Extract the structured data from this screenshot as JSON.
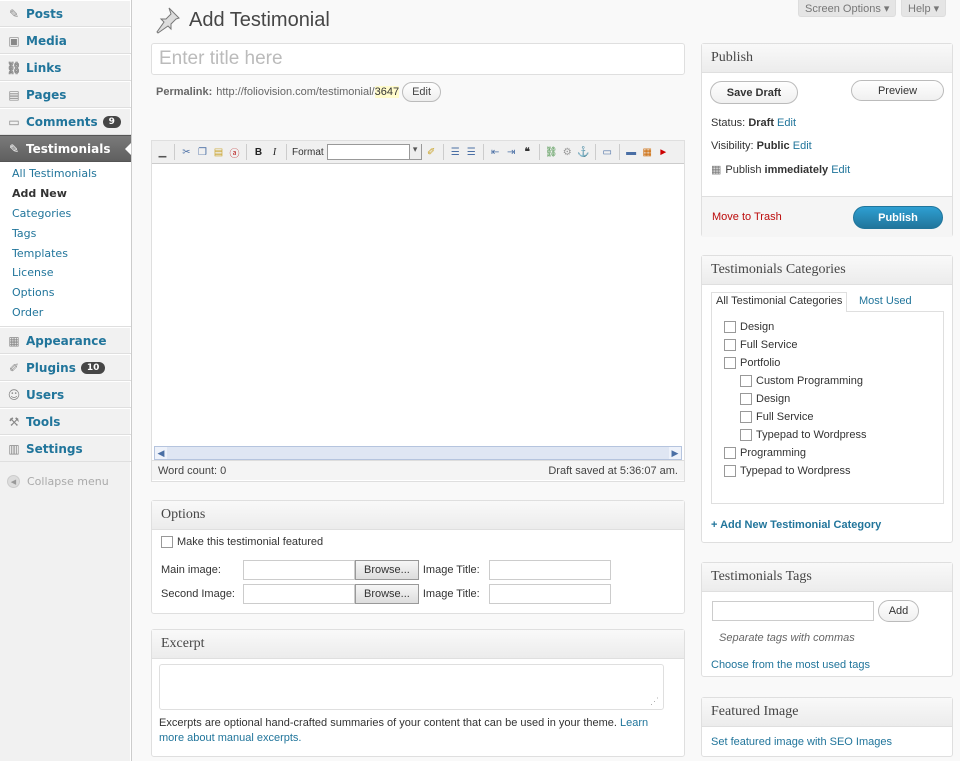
{
  "sidebar": {
    "items": [
      {
        "label": "Posts",
        "icon": "pin-icon"
      },
      {
        "label": "Media",
        "icon": "media-icon"
      },
      {
        "label": "Links",
        "icon": "link-icon"
      },
      {
        "label": "Pages",
        "icon": "pages-icon"
      },
      {
        "label": "Comments",
        "icon": "comments-icon",
        "badge": "9"
      },
      {
        "label": "Testimonials",
        "icon": "pin-icon"
      }
    ],
    "submenu": [
      "All Testimonials",
      "Add New",
      "Categories",
      "Tags",
      "Templates",
      "License",
      "Options",
      "Order"
    ],
    "items_after": [
      {
        "label": "Appearance",
        "icon": "appearance-icon"
      },
      {
        "label": "Plugins",
        "icon": "plugins-icon",
        "badge": "10"
      },
      {
        "label": "Users",
        "icon": "users-icon"
      },
      {
        "label": "Tools",
        "icon": "tools-icon"
      },
      {
        "label": "Settings",
        "icon": "settings-icon"
      }
    ],
    "collapse_label": "Collapse menu"
  },
  "top": {
    "screen_options": "Screen Options ▾",
    "help": "Help ▾"
  },
  "page": {
    "title": "Add Testimonial",
    "title_placeholder": "Enter title here",
    "permalink_label": "Permalink:",
    "permalink_base": "http://foliovision.com/testimonial/",
    "permalink_slug": "3647",
    "permalink_edit": "Edit"
  },
  "editor": {
    "format_label": "Format",
    "word_count": "Word count: 0",
    "draft_saved": "Draft saved at 5:36:07 am."
  },
  "options_box": {
    "title": "Options",
    "featured_label": "Make this testimonial featured",
    "main_image_label": "Main image:",
    "second_image_label": "Second Image:",
    "browse_label": "Browse...",
    "image_title_label": "Image Title:"
  },
  "excerpt_box": {
    "title": "Excerpt",
    "help_text": "Excerpts are optional hand-crafted summaries of your content that can be used in your theme. ",
    "link_text": "Learn more about manual excerpts."
  },
  "publish": {
    "title": "Publish",
    "save_draft": "Save Draft",
    "preview": "Preview",
    "status_label": "Status:",
    "status_value": "Draft",
    "visibility_label": "Visibility:",
    "visibility_value": "Public",
    "publish_label": "Publish",
    "publish_value": "immediately",
    "edit": "Edit",
    "trash": "Move to Trash",
    "publish_button": "Publish"
  },
  "categories": {
    "title": "Testimonials Categories",
    "tab_all": "All Testimonial Categories",
    "tab_most": "Most Used",
    "items": [
      {
        "label": "Design",
        "level": 0
      },
      {
        "label": "Full Service",
        "level": 0
      },
      {
        "label": "Portfolio",
        "level": 0
      },
      {
        "label": "Custom Programming",
        "level": 1
      },
      {
        "label": "Design",
        "level": 1
      },
      {
        "label": "Full Service",
        "level": 1
      },
      {
        "label": "Typepad to Wordpress",
        "level": 1
      },
      {
        "label": "Programming",
        "level": 0
      },
      {
        "label": "Typepad to Wordpress",
        "level": 0
      }
    ],
    "add_new": "+ Add New Testimonial Category"
  },
  "tags": {
    "title": "Testimonials Tags",
    "add": "Add",
    "help": "Separate tags with commas",
    "choose": "Choose from the most used tags"
  },
  "featured_image": {
    "title": "Featured Image",
    "link": "Set featured image with SEO Images"
  }
}
